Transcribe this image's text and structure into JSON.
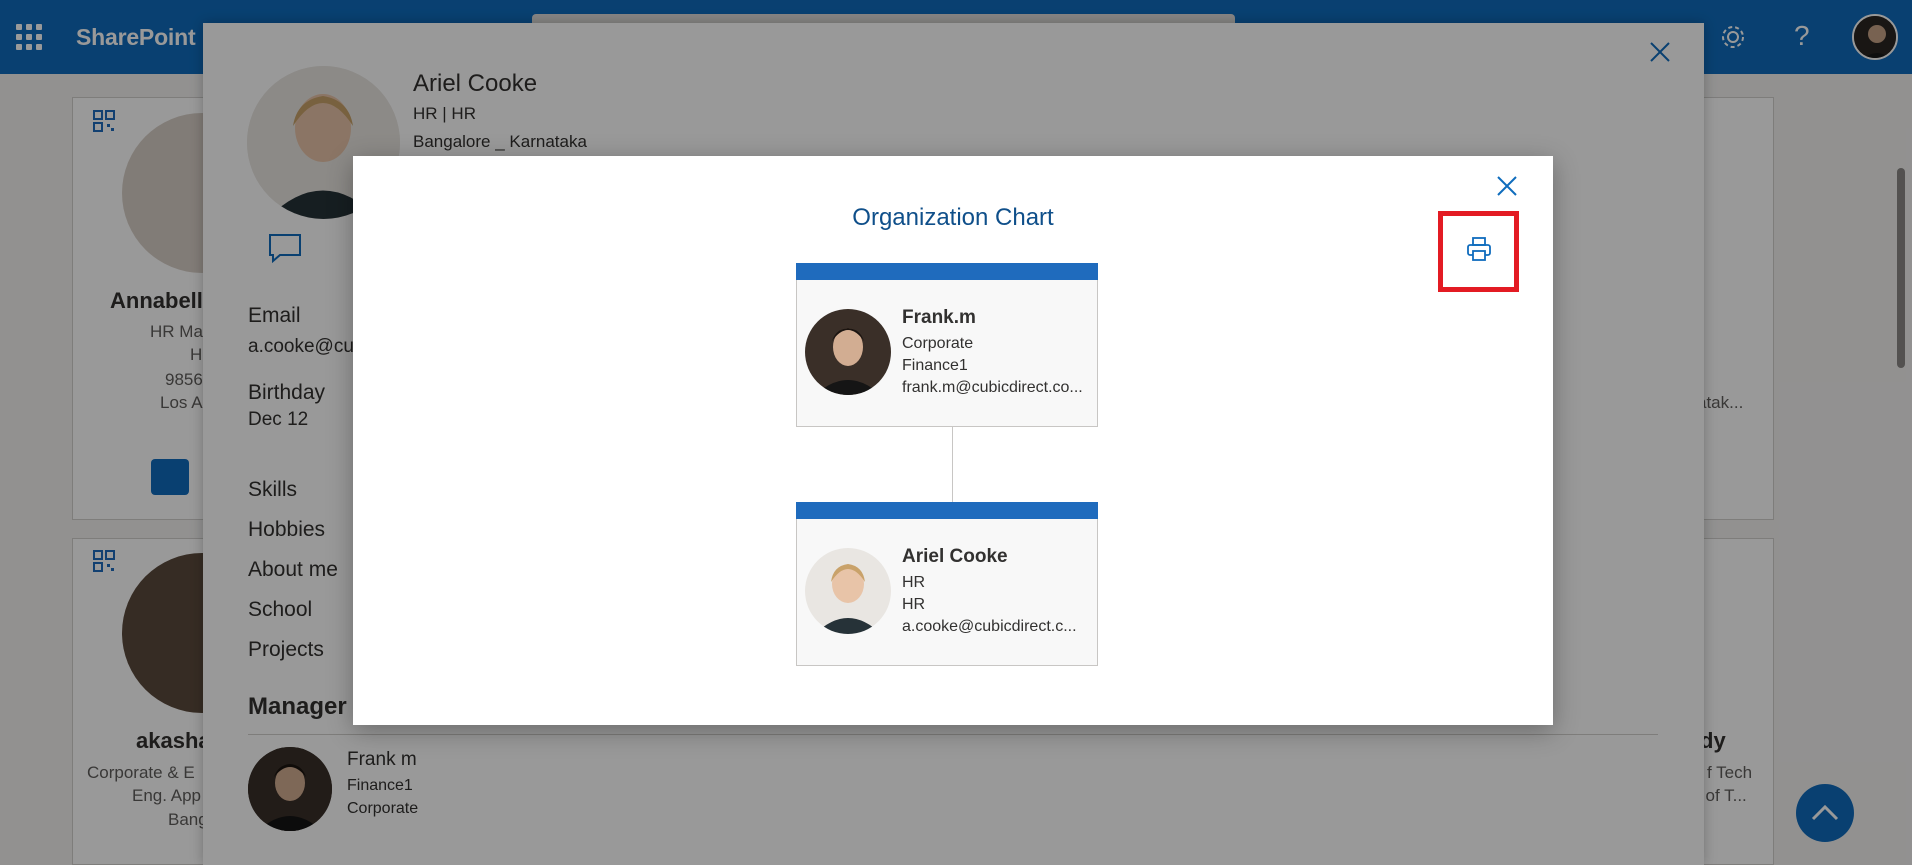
{
  "suite_bar": {
    "brand": "SharePoint",
    "icons": {
      "app_launcher": "waffle-icon",
      "settings": "gear-icon",
      "help": "help-icon"
    }
  },
  "background_cards": {
    "card1": {
      "name": "Annabella",
      "line1": "HR Ma",
      "line2": "H",
      "phone": "9856",
      "location": "Los A"
    },
    "card2": {
      "name": "akasha",
      "line1": "Corporate & E",
      "line2": "Eng. App",
      "location": "Bang"
    },
    "card3": {
      "name": "dy",
      "line1": "f Tech",
      "line2": "l of T..."
    },
    "card4": {
      "location": "atak..."
    }
  },
  "profile_panel": {
    "name": "Ariel Cooke",
    "dept": "HR | HR",
    "location": "Bangalore _ Karnataka",
    "email_label": "Email",
    "email_value": "a.cooke@cu",
    "birthday_label": "Birthday",
    "birthday_value": "Dec 12",
    "sections": [
      "Skills",
      "Hobbies",
      "About me",
      "School",
      "Projects"
    ],
    "manager_heading": "Manager",
    "manager": {
      "name": "Frank m",
      "line1": "Finance1",
      "line2": "Corporate"
    }
  },
  "org_chart_dialog": {
    "title": "Organization Chart",
    "print_icon": "printer-icon",
    "close_icon": "close-icon",
    "nodes": [
      {
        "name": "Frank.m",
        "line1": "Corporate",
        "line2": "Finance1",
        "email": "frank.m@cubicdirect.co..."
      },
      {
        "name": "Ariel Cooke",
        "line1": "HR",
        "line2": "HR",
        "email": "a.cooke@cubicdirect.c..."
      }
    ]
  },
  "colors": {
    "brand_blue": "#0f6cbd",
    "node_header": "#1f6bbd",
    "title_text": "#0f4f8a",
    "highlight_red": "#e31b23"
  }
}
